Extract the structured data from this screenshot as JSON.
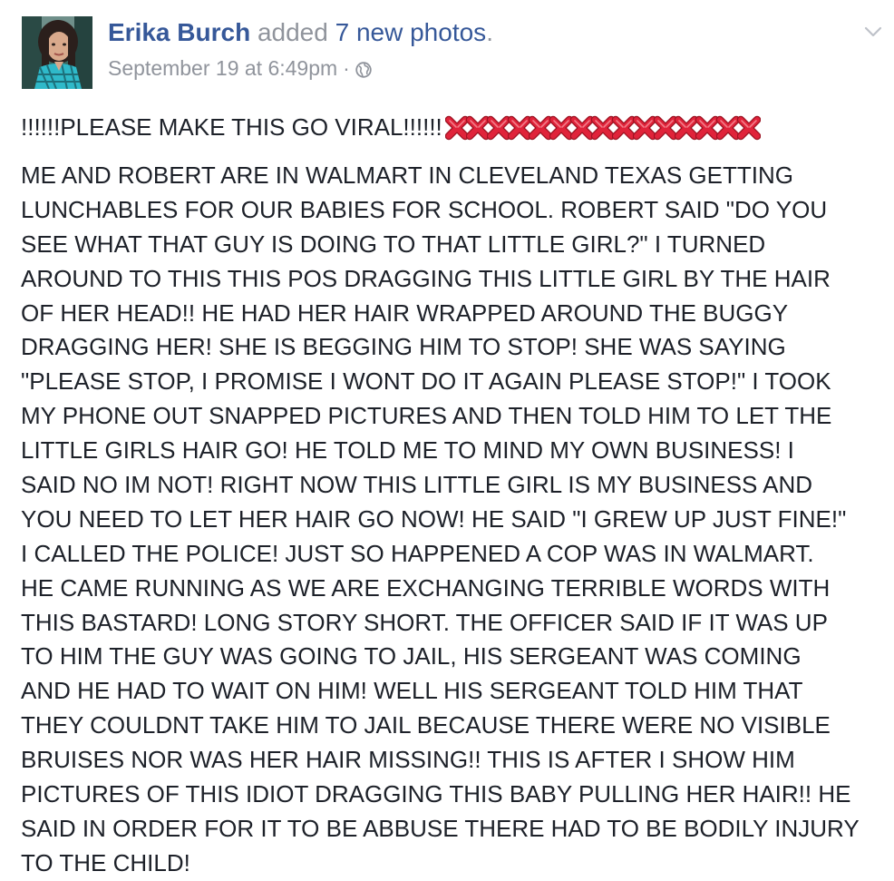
{
  "post": {
    "author": "Erika Burch",
    "action": "added",
    "photos_link": "7 new photos",
    "period": ".",
    "timestamp": "September 19 at 6:49pm",
    "separator": "·",
    "privacy_icon": "globe-icon",
    "menu_icon": "chevron-down-icon",
    "first_line_text": "!!!!!!PLEASE MAKE THIS GO VIRAL!!!!!!",
    "x_mark_count": 15,
    "x_mark_icon": "cross-mark-icon",
    "body_lines": [
      "ME AND ROBERT ARE IN WALMART IN CLEVELAND TEXAS GETTING",
      "LUNCHABLES FOR OUR BABIES FOR SCHOOL. ROBERT SAID \"DO YOU",
      "SEE WHAT THAT GUY IS DOING TO THAT LITTLE GIRL?\" I TURNED",
      "AROUND TO THIS THIS POS DRAGGING THIS LITTLE GIRL BY THE HAIR",
      "OF HER HEAD!! HE HAD HER HAIR WRAPPED AROUND THE BUGGY",
      "DRAGGING HER! SHE IS BEGGING HIM TO STOP! SHE WAS SAYING",
      "\"PLEASE STOP, I PROMISE I WONT DO IT AGAIN PLEASE STOP!\" I TOOK",
      "MY PHONE OUT SNAPPED PICTURES AND THEN TOLD HIM TO LET THE",
      "LITTLE GIRLS HAIR GO! HE TOLD ME TO MIND MY OWN BUSINESS! I",
      "SAID NO IM NOT! RIGHT NOW THIS LITTLE GIRL IS MY BUSINESS AND",
      "YOU NEED TO LET HER HAIR GO NOW! HE SAID \"I GREW UP JUST FINE!\"",
      "I CALLED THE POLICE! JUST SO HAPPENED A COP WAS IN WALMART.",
      "HE CAME RUNNING AS WE ARE EXCHANGING TERRIBLE WORDS WITH",
      "THIS BASTARD! LONG STORY SHORT. THE OFFICER SAID IF IT WAS UP",
      "TO HIM THE GUY WAS GOING TO JAIL, HIS SERGEANT WAS COMING",
      "AND HE HAD TO WAIT ON HIM! WELL HIS SERGEANT TOLD HIM THAT",
      "THEY COULDNT TAKE HIM TO JAIL BECAUSE THERE WERE NO VISIBLE",
      "BRUISES NOR WAS HER HAIR MISSING!! THIS IS AFTER I SHOW HIM",
      "PICTURES OF THIS IDIOT DRAGGING THIS BABY PULLING HER HAIR!! HE",
      "SAID IN ORDER FOR IT TO BE ABBUSE THERE HAD TO BE BODILY INJURY",
      "TO THE CHILD!"
    ]
  },
  "colors": {
    "link_blue": "#365899",
    "meta_gray": "#90949c",
    "text": "#1d2129",
    "x_mark_red": "#e0233a"
  }
}
